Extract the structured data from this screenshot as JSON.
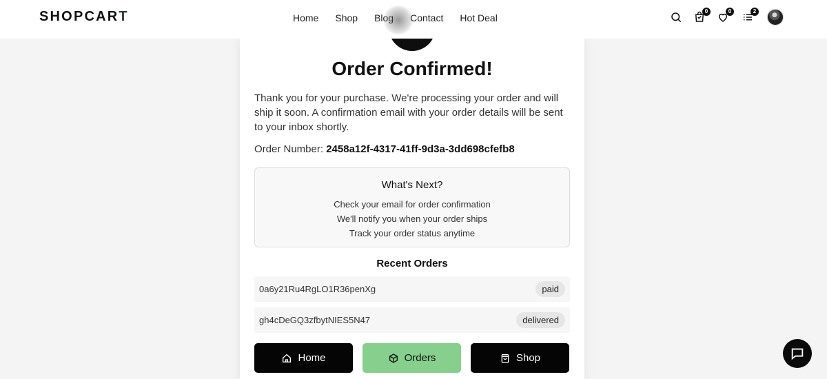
{
  "brand": {
    "name_main": "SHOPCAR",
    "name_last": "T"
  },
  "nav": {
    "items": [
      "Home",
      "Shop",
      "Blog",
      "Contact",
      "Hot Deal"
    ]
  },
  "header_icons": {
    "search": "search-icon",
    "cart": {
      "icon": "cart-icon",
      "count": "0"
    },
    "wishlist": {
      "icon": "heart-icon",
      "count": "0"
    },
    "compare": {
      "icon": "list-icon",
      "count": "2"
    },
    "avatar": "user-avatar"
  },
  "confirmation": {
    "title": "Order Confirmed!",
    "message": "Thank you for your purchase. We're processing your order and will ship it soon. A confirmation email with your order details will be sent to your inbox shortly.",
    "order_number_label": "Order Number:",
    "order_number": "2458a12f-4317-41ff-9d3a-3dd698cfefb8"
  },
  "whats_next": {
    "title": "What's Next?",
    "items": [
      "Check your email for order confirmation",
      "We'll notify you when your order ships",
      "Track your order status anytime"
    ]
  },
  "recent_orders": {
    "title": "Recent Orders",
    "rows": [
      {
        "id": "0a6y21Ru4RgLO1R36penXg",
        "status": "paid"
      },
      {
        "id": "gh4cDeGQ3zfbytNIES5N47",
        "status": "delivered"
      }
    ]
  },
  "actions": {
    "home": "Home",
    "orders": "Orders",
    "shop": "Shop"
  },
  "colors": {
    "accent_green": "#86cf8c",
    "dark": "#050505",
    "background": "#f4f4f4"
  }
}
